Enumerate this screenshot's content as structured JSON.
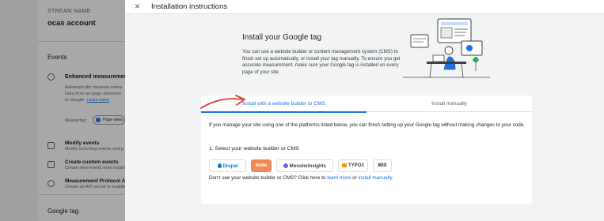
{
  "left_page": {
    "stream_name_label": "STREAM NAME",
    "stream_name_value": "ocas account",
    "events_heading": "Events",
    "enhanced_title": "Enhanced measurement",
    "enhanced_desc_1": "Automatically measure intera",
    "enhanced_desc_2": "Data from on-page elements",
    "enhanced_desc_3": "to Google.",
    "learn_more": "Learn more",
    "measuring_label": "Measuring:",
    "page_views_pill": "Page views",
    "modify_title": "Modify events",
    "modify_desc": "Modify incoming events and p",
    "create_title": "Create custom events",
    "create_desc": "Create new events from existin",
    "protocol_title": "Measurement Protocol AP",
    "protocol_desc": "Create an API secret to enable",
    "google_tag_heading": "Google tag"
  },
  "panel": {
    "close_glyph": "×",
    "title": "Installation instructions",
    "intro_title": "Install your Google tag",
    "intro_body": "You can use a website builder or content management system (CMS) to finish set up automatically, or install your tag manually. To ensure you get accurate measurement, make sure your Google tag is installed on every page of your site.",
    "tabs": [
      "Install with a website builder or CMS",
      "Install manually"
    ],
    "description": "If you manage your site using one of the platforms listed below, you can finish setting up your Google tag without making changes to your code.",
    "step_label": "1. Select your website builder or CMS",
    "cms_options": [
      "Drupal",
      "dude",
      "MonsterInsights",
      "TYPO3",
      "WIX"
    ],
    "footer_prefix": "Don't see your website builder or CMS? Click here to ",
    "footer_link_1": "learn more",
    "footer_mid": " or ",
    "footer_link_2": "install manually",
    "footer_suffix": "."
  },
  "colors": {
    "accent": "#1a73e8",
    "annotation_arrow": "#e53935",
    "drupal": "#0678be",
    "dude": "#f08a55",
    "typo3": "#f49700"
  }
}
